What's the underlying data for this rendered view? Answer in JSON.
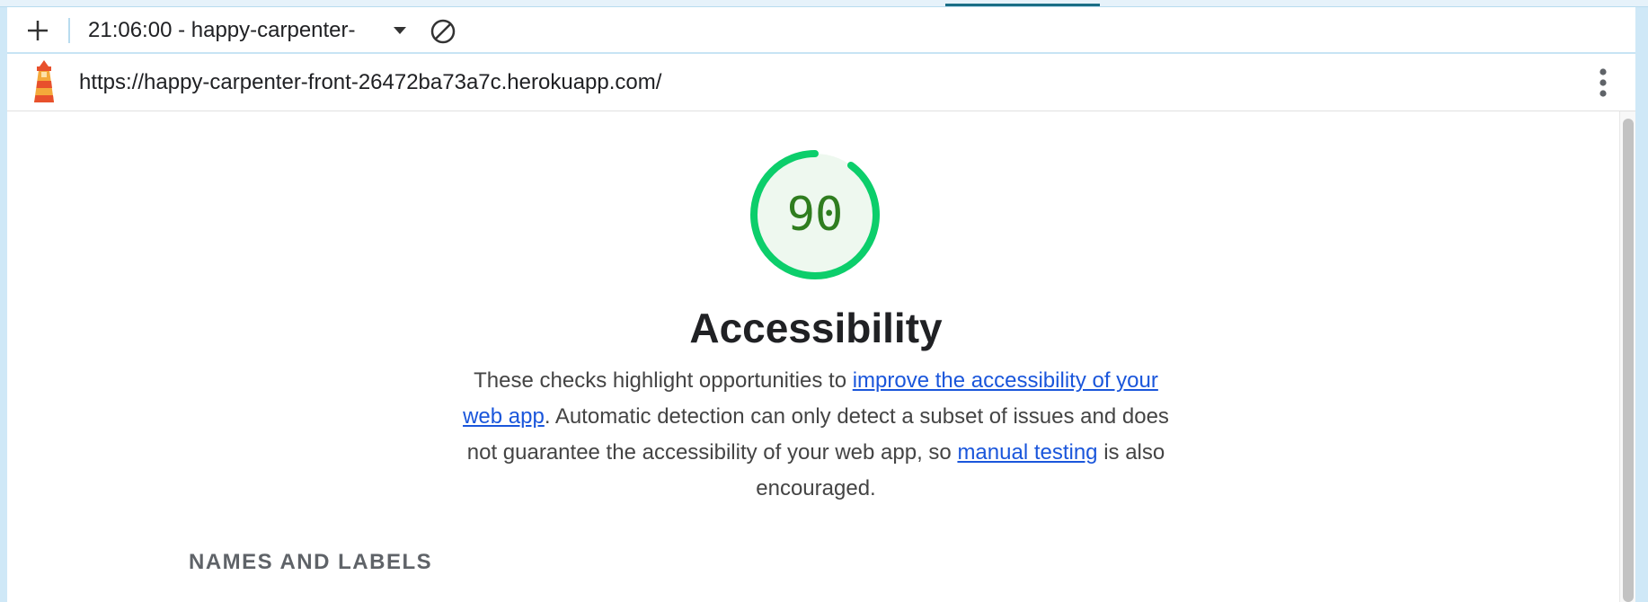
{
  "toolbar": {
    "add_icon": "plus-icon",
    "report_select_label": "21:06:00 - happy-carpenter-",
    "dropdown_icon": "caret-down-icon",
    "clear_icon": "block-icon"
  },
  "urlbar": {
    "logo_icon": "lighthouse-icon",
    "url": "https://happy-carpenter-front-26472ba73a7c.herokuapp.com/",
    "menu_icon": "kebab-menu-icon"
  },
  "category": {
    "score": "90",
    "score_fraction": 0.9,
    "gauge_color": "#0cce6b",
    "gauge_fill": "#eef8ef",
    "score_text_color": "#2f7d1f",
    "title": "Accessibility",
    "description": {
      "part1": "These checks highlight opportunities to ",
      "link1": "improve the accessibility of your web app",
      "part2": ". Automatic detection can only detect a subset of issues and does not guarantee the accessibility of your web app, so ",
      "link2": "manual testing",
      "part3": " is also encouraged."
    },
    "group_title": "NAMES AND LABELS"
  },
  "colors": {
    "link": "#1a56db",
    "frame_accent": "#cfe8f7",
    "active_tab_line": "#1a6e86"
  }
}
